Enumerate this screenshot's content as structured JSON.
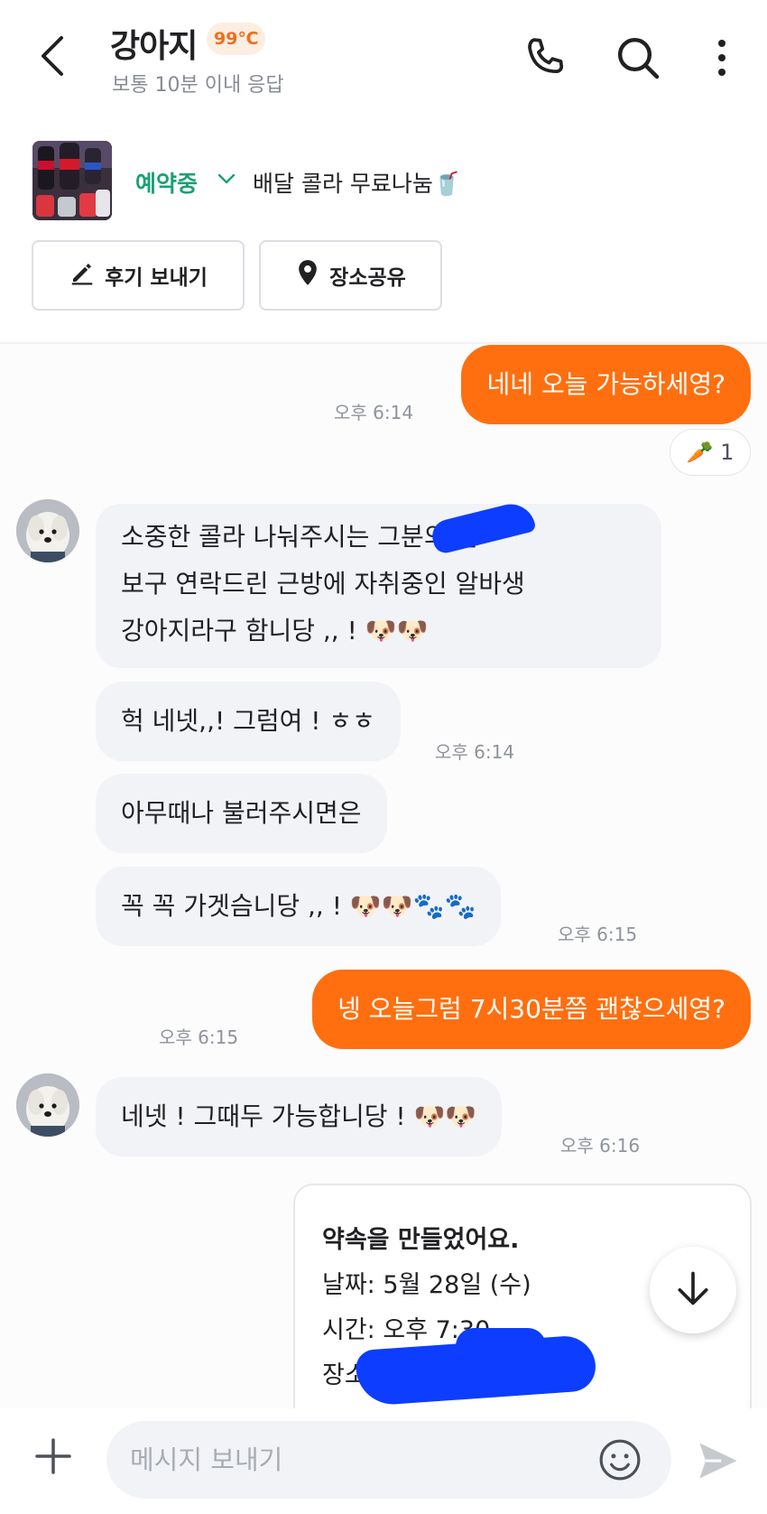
{
  "colors": {
    "accent": "#ff6f0f",
    "status_green": "#1aa174",
    "temp_orange": "#f06f1c",
    "scribble_blue": "#0d3dff"
  },
  "header": {
    "title": "강아지",
    "temperature": "99℃",
    "subtitle": "보통 10분 이내 응답",
    "icons": [
      "back-arrow-icon",
      "phone-icon",
      "search-icon",
      "more-vertical-icon"
    ]
  },
  "product": {
    "status": "예약중",
    "title": "배달 콜라 무료나눔🥤",
    "review_button": "후기 보내기",
    "place_button": "장소공유"
  },
  "messages": [
    {
      "id": "m1",
      "from": "me",
      "text": "네네 오늘 가능하세영?",
      "time": "오후 6:14"
    },
    {
      "id": "reaction",
      "text": "🥕 1"
    },
    {
      "id": "m2",
      "from": "other",
      "lines": [
        "소중한 콜라 나눠주시는 그분의 글",
        "보구 연락드린 근방에 자취중인 알바생",
        "강아지라구 함니당 ,, ! 🐶🐶"
      ]
    },
    {
      "id": "m3",
      "from": "other",
      "text": "헉 네넷,,! 그럼여 ! ㅎㅎ",
      "time": "오후 6:14"
    },
    {
      "id": "m4",
      "from": "other",
      "text": "아무때나 불러주시면은"
    },
    {
      "id": "m5",
      "from": "other",
      "text": "꼭 꼭 가겟슴니당 ,, ! 🐶🐶🐾🐾",
      "time": "오후 6:15"
    },
    {
      "id": "m6",
      "from": "me",
      "text": "넹 오늘그럼 7시30분쯤 괜찮으세영?",
      "time": "오후 6:15"
    },
    {
      "id": "m7",
      "from": "other",
      "text": "네넷 ! 그때두 가능합니당 ! 🐶🐶",
      "time": "오후 6:16"
    }
  ],
  "appointment": {
    "title": "약속을 만들었어요.",
    "date": "날짜: 5월 28일 (수)",
    "time": "시간: 오후 7:30",
    "place": "장소:"
  },
  "composer": {
    "placeholder": "메시지 보내기"
  }
}
